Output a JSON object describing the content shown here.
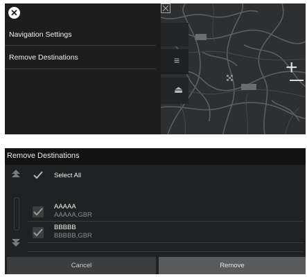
{
  "top_menu": {
    "close_icon": "close-icon",
    "items": [
      {
        "label": "Navigation Settings"
      },
      {
        "label": "Remove Destinations"
      }
    ]
  },
  "map": {
    "zoom_in_icon": "plus-icon",
    "zoom_out_icon": "minus-icon",
    "fullscreen_icon": "expand-icon"
  },
  "dialog": {
    "title": "Remove Destinations",
    "select_all": "Select All",
    "items": [
      {
        "name": "AAAAA",
        "detail": "AAAAA,GBR"
      },
      {
        "name": "BBBBB",
        "detail": "BBBBB,GBR"
      }
    ],
    "cancel_label": "Cancel",
    "remove_label": "Remove"
  },
  "colors": {
    "panel": "#1d1d1e",
    "dialog_bg": "#202122",
    "header_bg": "#121212",
    "remove_button": "#5a5b5d",
    "cancel_button": "#3c3d3f"
  }
}
